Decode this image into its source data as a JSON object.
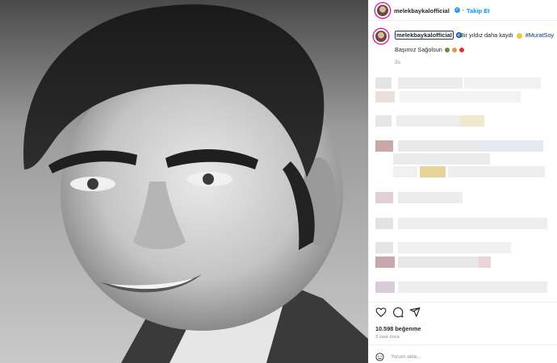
{
  "post": {
    "username": "melekbaykalofficial",
    "follow_label": "Takip Et",
    "caption_text": "Bir yıldız daha kaydı",
    "hashtag": "#MuratSoy",
    "caption_line2": "Başımız Sağolsun",
    "caption_time": "3s",
    "likes": "10.598 beğenme",
    "posted_ago": "3 saat önce",
    "comment_placeholder": "Yorum ekle...",
    "accent_color": "#0095f6",
    "icons": [
      "verified-badge",
      "heart-icon",
      "comment-icon",
      "share-icon",
      "emoji-icon"
    ]
  }
}
